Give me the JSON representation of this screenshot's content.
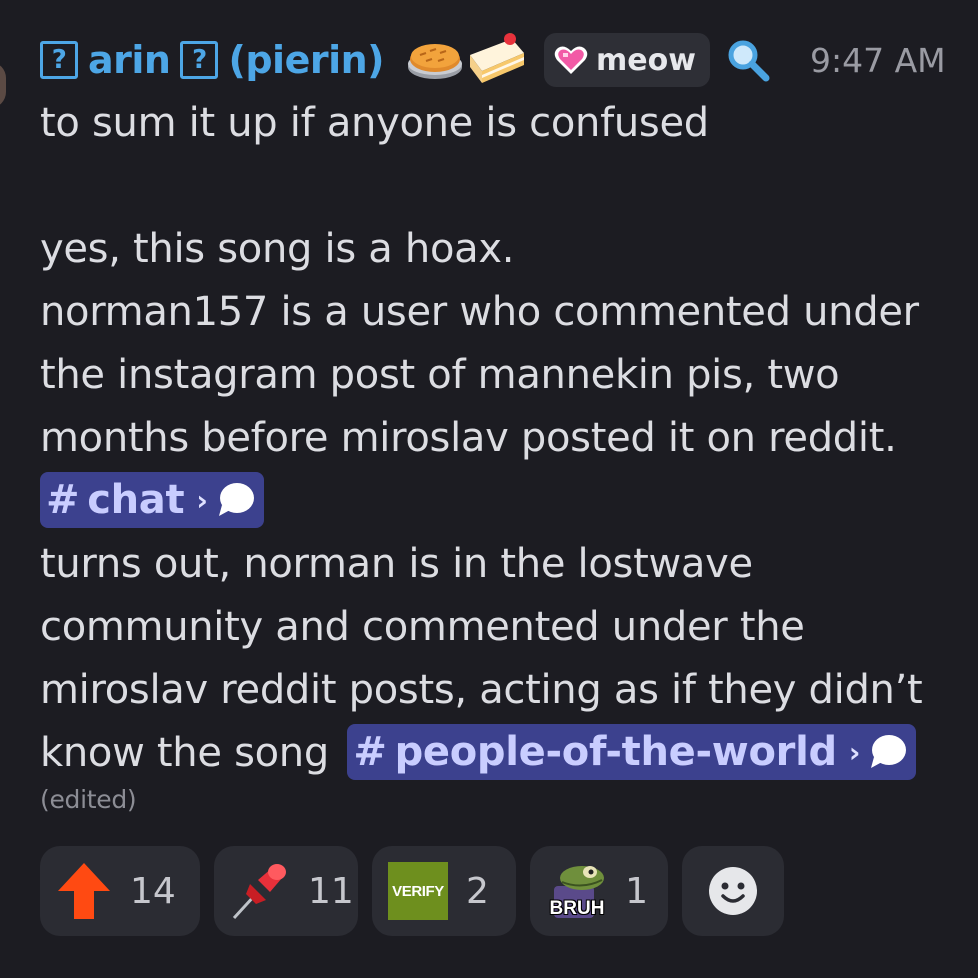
{
  "message": {
    "author": {
      "badge_left": "?",
      "name": "arin",
      "badge_right": "?",
      "pronoun_name": "(pierin)",
      "decorations": [
        "pie-icon",
        "cake-slice-icon"
      ]
    },
    "tag": {
      "icon": "pixel-heart-icon",
      "label": "meow"
    },
    "timestamp": "9:47 AM",
    "lines": {
      "l1": "to sum it up if anyone is confused",
      "l2": "yes, this song is a hoax.",
      "l3": "norman157 is a user who commented under",
      "l4": "the instagram post of mannekin pis, two",
      "l5": "months before miroslav posted it on reddit.",
      "l7": "turns out, norman is in the lostwave",
      "l8": "community and commented under the",
      "l9": "miroslav reddit posts, acting as if they didn’t",
      "l10": "know the song"
    },
    "mentions": {
      "chat": {
        "hash": "#",
        "label": "chat",
        "chevron": "›"
      },
      "people": {
        "hash": "#",
        "label": "people-of-the-world",
        "chevron": "›"
      }
    },
    "edited": "(edited)"
  },
  "reactions": [
    {
      "emoji": "red-up-arrow-icon",
      "count": "14"
    },
    {
      "emoji": "pushpin-icon",
      "count": "11"
    },
    {
      "emoji": "verify-icon",
      "emoji_text": "VERIFY",
      "count": "2"
    },
    {
      "emoji": "bruh-frog-icon",
      "emoji_text": "BRUH",
      "count": "1"
    }
  ],
  "add_reaction": {
    "icon": "smiley-icon"
  },
  "colors": {
    "background": "#1c1c22",
    "username": "#4da6e6",
    "mention_bg": "#3c418e",
    "mention_text": "#c9cdff",
    "reaction_bg": "#2b2c33",
    "verify_green": "#6e8f1e"
  }
}
